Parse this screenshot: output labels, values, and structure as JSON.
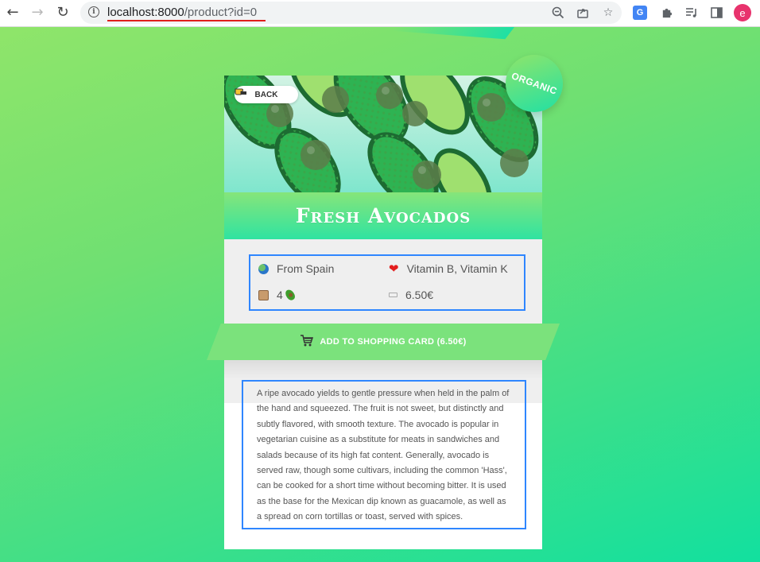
{
  "browser": {
    "url_host": "localhost:8000",
    "url_path": "/product?id=0",
    "profile_initial": "e",
    "icons": {
      "back": "arrow-left-icon",
      "forward": "arrow-right-icon",
      "reload": "reload-icon",
      "site_info": "info-icon",
      "zoom": "zoom-out-icon",
      "share": "share-icon",
      "bookmark": "star-icon",
      "translate": "translate-icon",
      "extensions": "puzzle-icon",
      "reading_list": "reading-list-icon",
      "side_panel": "side-panel-icon"
    },
    "accent_color": "#e8336d",
    "underline_color": "#e0201b"
  },
  "product": {
    "back_label": "BACK",
    "badge": "ORGANIC",
    "title": "Fresh Avocados",
    "origin": "From Spain",
    "nutrients": "Vitamin B, Vitamin K",
    "quantity": "4",
    "price": "6.50€",
    "add_to_cart_label": "ADD TO SHOPPING CARD (6.50€)",
    "description": "A ripe avocado yields to gentle pressure when held in the palm of the hand and squeezed. The fruit is not sweet, but distinctly and subtly flavored, with smooth texture. The avocado is popular in vegetarian cuisine as a substitute for meats in sandwiches and salads because of its high fat content. Generally, avocado is served raw, though some cultivars, including the common 'Hass', can be cooked for a short time without becoming bitter. It is used as the base for the Mexican dip known as guacamole, as well as a spread on corn tortillas or toast, served with spices.",
    "icons": {
      "back": "pointing-hand-icon",
      "origin": "globe-icon",
      "nutrients": "heart-icon",
      "quantity": "box-icon",
      "quantity_unit": "avocado-icon",
      "price": "price-tag-icon",
      "cart": "shopping-cart-icon"
    },
    "colors": {
      "brand_green": "#7be27c",
      "teal": "#21e0a4",
      "highlight_border": "#2f86ff"
    }
  }
}
